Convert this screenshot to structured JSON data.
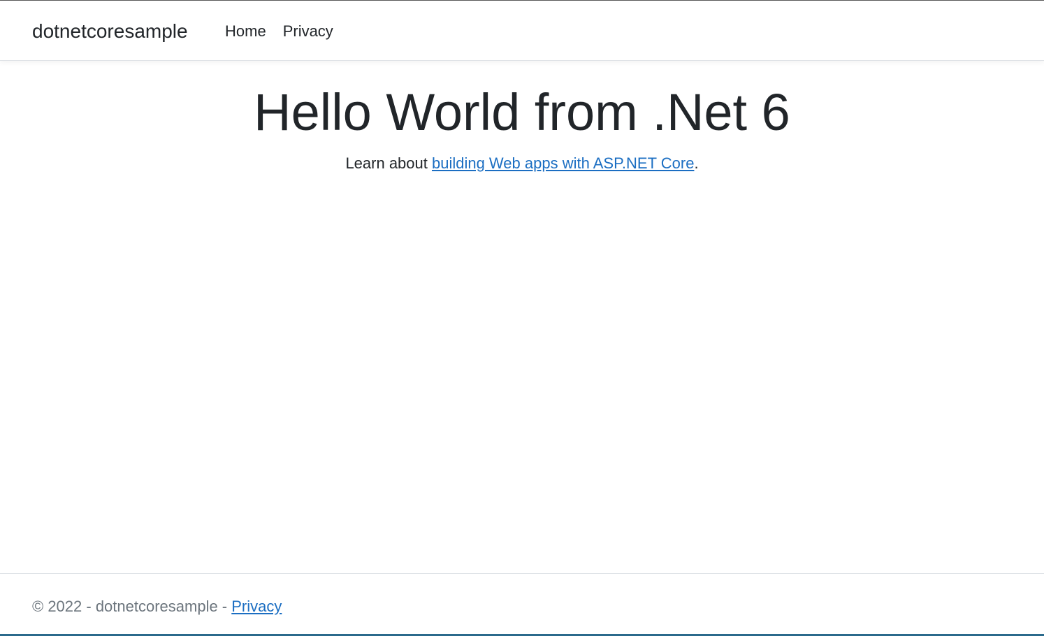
{
  "navbar": {
    "brand": "dotnetcoresample",
    "links": [
      {
        "label": "Home"
      },
      {
        "label": "Privacy"
      }
    ]
  },
  "main": {
    "heading": "Hello World from .Net 6",
    "text_prefix": "Learn about ",
    "link_label": "building Web apps with ASP.NET Core",
    "text_suffix": "."
  },
  "footer": {
    "copyright": "© 2022 - dotnetcoresample - ",
    "privacy_label": "Privacy"
  },
  "colors": {
    "link": "#1b6ec2",
    "text": "#212529",
    "muted": "#6c757d"
  }
}
